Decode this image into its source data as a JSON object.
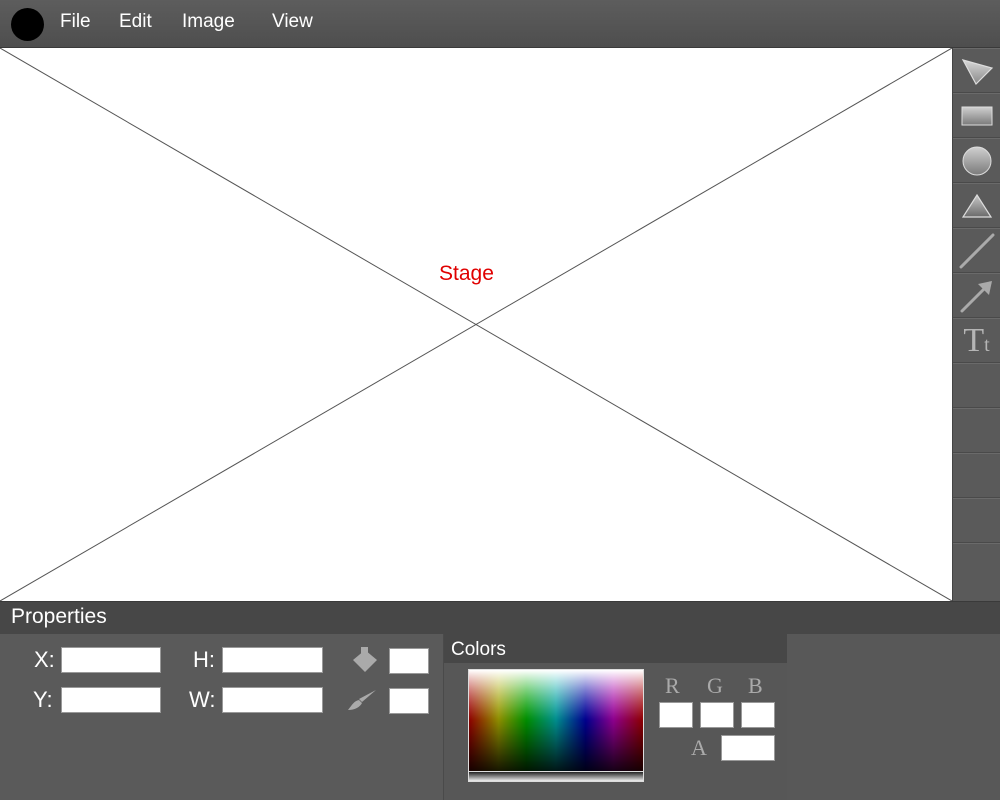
{
  "menu": {
    "items": [
      {
        "label": "File"
      },
      {
        "label": "Edit"
      },
      {
        "label": "Image"
      },
      {
        "label": "View"
      }
    ]
  },
  "stage": {
    "label": "Stage",
    "label_color": "#e00000"
  },
  "toolbox": {
    "tools": [
      {
        "icon": "select-arrow-icon"
      },
      {
        "icon": "rectangle-icon"
      },
      {
        "icon": "circle-icon"
      },
      {
        "icon": "triangle-icon"
      },
      {
        "icon": "line-icon"
      },
      {
        "icon": "arrow-icon"
      },
      {
        "icon": "text-icon",
        "glyph_big": "T",
        "glyph_small": "t"
      }
    ]
  },
  "properties": {
    "title": "Properties",
    "x_label": "X:",
    "y_label": "Y:",
    "h_label": "H:",
    "w_label": "W:",
    "x_value": "",
    "y_value": "",
    "h_value": "",
    "w_value": "",
    "fill_icon": "paint-bucket-icon",
    "stroke_icon": "brush-icon"
  },
  "colors": {
    "title": "Colors",
    "r_label": "R",
    "g_label": "G",
    "b_label": "B",
    "a_label": "A",
    "r_value": "",
    "g_value": "",
    "b_value": "",
    "a_value": ""
  }
}
